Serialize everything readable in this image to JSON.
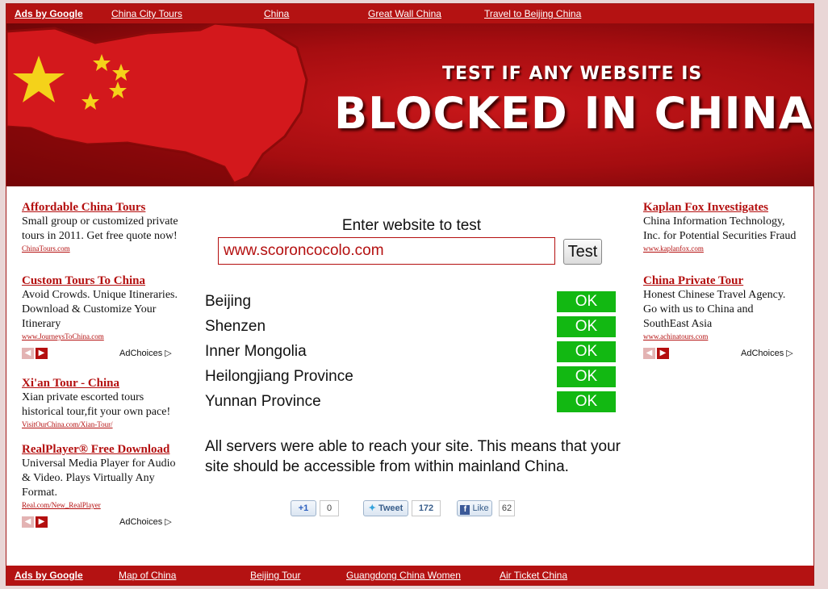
{
  "top_bar": {
    "ads_label": "Ads by Google",
    "links": [
      "China City Tours",
      "China",
      "Great Wall China",
      "Travel to Beijing China"
    ]
  },
  "banner": {
    "subtitle": "TEST IF ANY WEBSITE IS",
    "title": "BLOCKED IN CHINA"
  },
  "left_ads": [
    {
      "title": "Affordable China Tours",
      "desc": "Small group or customized private tours in 2011. Get free quote now!",
      "url": "ChinaTours.com"
    },
    {
      "title": "Custom Tours To China",
      "desc": "Avoid Crowds. Unique Itineraries. Download & Customize Your Itinerary",
      "url": "www.JourneysToChina.com"
    },
    {
      "title": "Xi'an Tour - China",
      "desc": "Xian private escorted tours historical tour,fit your own pace!",
      "url": "VisitOurChina.com/Xian-Tour/"
    },
    {
      "title": "RealPlayer® Free Download",
      "desc": "Universal Media Player for Audio & Video. Plays Virtually Any Format.",
      "url": "Real.com/New_RealPlayer"
    }
  ],
  "right_ads": [
    {
      "title": "Kaplan Fox Investigates",
      "desc": "China Information Technology, Inc. for Potential Securities Fraud",
      "url": "www.kaplanfox.com"
    },
    {
      "title": "China Private Tour",
      "desc": "Honest Chinese Travel Agency. Go with us to China and SouthEast Asia",
      "url": "www.achinatours.com"
    }
  ],
  "adchoices_label": "AdChoices",
  "test_form": {
    "label": "Enter website to test",
    "input_value": "www.scoroncocolo.com",
    "button_label": "Test"
  },
  "results": [
    {
      "location": "Beijing",
      "status": "OK"
    },
    {
      "location": "Shenzen",
      "status": "OK"
    },
    {
      "location": "Inner Mongolia",
      "status": "OK"
    },
    {
      "location": "Heilongjiang Province",
      "status": "OK"
    },
    {
      "location": "Yunnan Province",
      "status": "OK"
    }
  ],
  "summary": "All servers were able to reach your site. This means that your site should be accessible from within mainland China.",
  "social": {
    "gplus_label": "+1",
    "gplus_count": "0",
    "tweet_label": "Tweet",
    "tweet_count": "172",
    "like_label": "Like",
    "like_count": "62"
  },
  "bottom_bar": {
    "ads_label": "Ads by Google",
    "links": [
      "Map of China",
      "Beijing Tour",
      "Guangdong China Women",
      "Air Ticket China"
    ]
  },
  "colors": {
    "brand_red": "#b41212",
    "ok_green": "#12b812",
    "ad_link": "#b40f0f"
  }
}
